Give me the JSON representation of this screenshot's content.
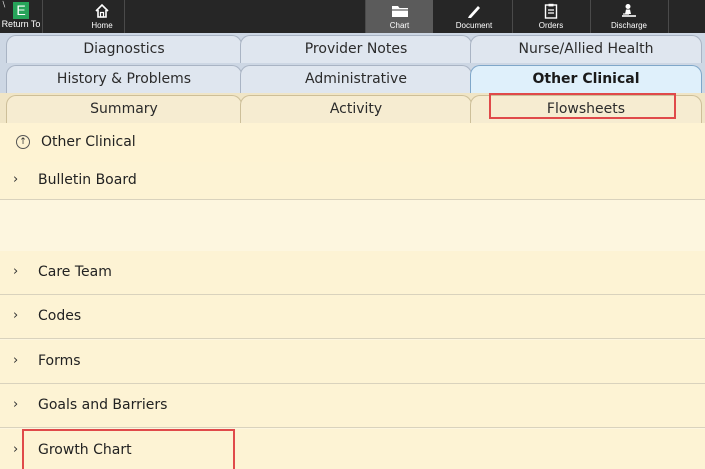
{
  "toolbar": {
    "return_label": "Return To",
    "logo_letter": "E",
    "home_label": "Home",
    "chart_label": "Chart",
    "document_label": "Document",
    "orders_label": "Orders",
    "discharge_label": "Discharge"
  },
  "tabs": {
    "row1": [
      "Diagnostics",
      "Provider Notes",
      "Nurse/Allied Health"
    ],
    "row2": [
      "History & Problems",
      "Administrative",
      "Other Clinical"
    ],
    "row3": [
      "Summary",
      "Activity",
      "Flowsheets"
    ],
    "active": "Other Clinical"
  },
  "section": {
    "title": "Other Clinical",
    "items": [
      "Bulletin Board",
      "Care Team",
      "Codes",
      "Forms",
      "Goals and Barriers",
      "Growth Chart"
    ]
  },
  "colors": {
    "toolbar_bg": "#262626",
    "logo_green": "#27a45a",
    "highlight_red": "#e04a4a",
    "content_bg": "#fdf3d4"
  }
}
